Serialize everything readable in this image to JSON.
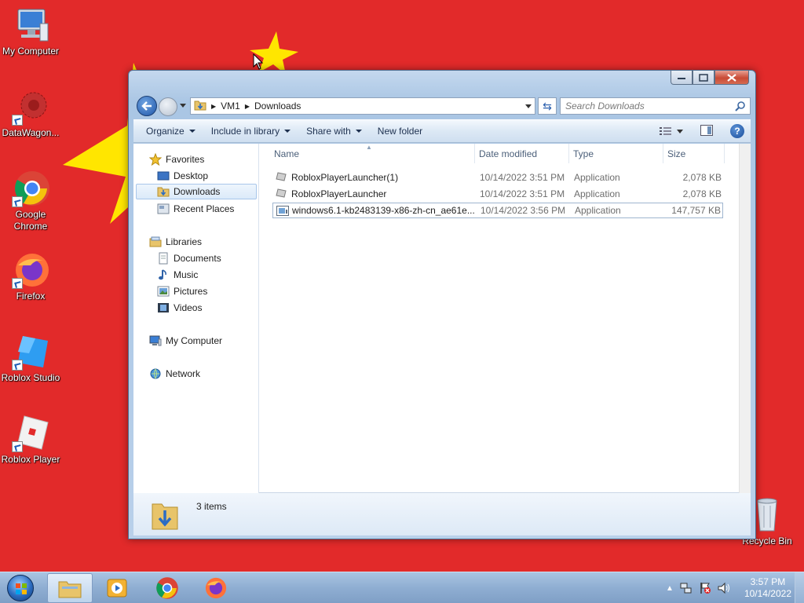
{
  "desktop": {
    "icons": [
      {
        "label": "My Computer",
        "icon": "computer-icon"
      },
      {
        "label": "DataWagon...",
        "icon": "datawagon-icon"
      },
      {
        "label": "Google Chrome",
        "icon": "chrome-icon"
      },
      {
        "label": "Firefox",
        "icon": "firefox-icon"
      },
      {
        "label": "Roblox Studio",
        "icon": "roblox-studio-icon"
      },
      {
        "label": "Roblox Player",
        "icon": "roblox-player-icon"
      },
      {
        "label": "Recycle Bin",
        "icon": "recycle-bin-icon"
      }
    ],
    "background_color": "#e22a2a",
    "star_color": "#ffe600"
  },
  "window": {
    "address": {
      "root": "VM1",
      "current": "Downloads"
    },
    "search": {
      "placeholder": "Search Downloads"
    },
    "toolbar": {
      "organize": "Organize",
      "include_in_library": "Include in library",
      "share_with": "Share with",
      "new_folder": "New folder"
    },
    "nav": {
      "favorites": "Favorites",
      "desktop": "Desktop",
      "downloads": "Downloads",
      "recent_places": "Recent Places",
      "libraries": "Libraries",
      "documents": "Documents",
      "music": "Music",
      "pictures": "Pictures",
      "videos": "Videos",
      "my_computer": "My Computer",
      "network": "Network"
    },
    "columns": {
      "name": "Name",
      "date_modified": "Date modified",
      "type": "Type",
      "size": "Size"
    },
    "files": [
      {
        "name": "RobloxPlayerLauncher(1)",
        "date": "10/14/2022 3:51 PM",
        "type": "Application",
        "size": "2,078 KB"
      },
      {
        "name": "RobloxPlayerLauncher",
        "date": "10/14/2022 3:51 PM",
        "type": "Application",
        "size": "2,078 KB"
      },
      {
        "name": "windows6.1-kb2483139-x86-zh-cn_ae61e...",
        "date": "10/14/2022 3:56 PM",
        "type": "Application",
        "size": "147,757 KB"
      }
    ],
    "status": {
      "count": "3 items"
    }
  },
  "taskbar": {
    "pinned": [
      "explorer-icon",
      "media-player-icon",
      "chrome-icon",
      "firefox-icon"
    ],
    "clock": {
      "time": "3:57 PM",
      "date": "10/14/2022"
    }
  }
}
